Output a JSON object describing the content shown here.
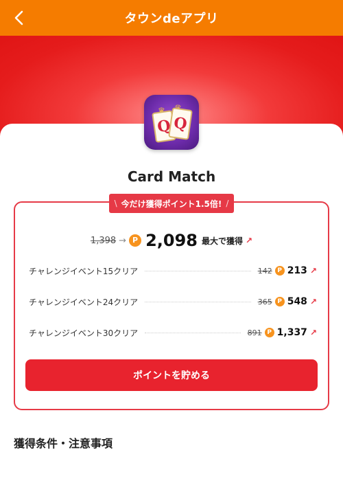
{
  "header": {
    "title": "タウンdeアプリ",
    "back_icon": "chevron-left-icon",
    "color": "#f57c00"
  },
  "app": {
    "name": "Card Match",
    "icon": "queen-cards-icon"
  },
  "campaign": {
    "ribbon": "今だけ獲得ポイント1.5倍!",
    "old_points": "1,398",
    "new_points": "2,098",
    "suffix": "最大で獲得",
    "accent": "#e63946"
  },
  "rewards": [
    {
      "label": "チャレンジイベント15クリア",
      "old": "142",
      "new": "213"
    },
    {
      "label": "チャレンジイベント24クリア",
      "old": "365",
      "new": "548"
    },
    {
      "label": "チャレンジイベント30クリア",
      "old": "891",
      "new": "1,337"
    }
  ],
  "cta": {
    "label": "ポイントを貯める"
  },
  "section": {
    "title": "獲得条件・注意事項"
  },
  "coin_glyph": "P",
  "arrow_glyph": "→",
  "external_glyph": "↗"
}
